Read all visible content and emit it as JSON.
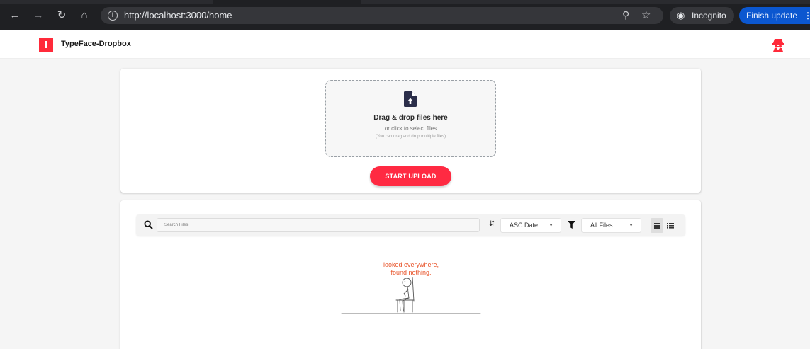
{
  "browser": {
    "url": "http://localhost:3000/home",
    "incognito_label": "Incognito",
    "finish_update_label": "Finish update",
    "icons": [
      "back-icon",
      "forward-icon",
      "reload-icon",
      "home-icon",
      "info-icon",
      "zoom-icon",
      "star-icon",
      "incognito-icon",
      "menu-dots-icon"
    ]
  },
  "header": {
    "brand": "TypeFace-Dropbox",
    "brand_color": "#ff2a3a"
  },
  "upload": {
    "title": "Drag & drop files here",
    "subtitle": "or click to select files",
    "hint": "(You can drag and drop multiple files)",
    "button_label": "START UPLOAD",
    "button_color": "#ff2a42"
  },
  "files": {
    "search_placeholder": "Search Files",
    "sort_value": "ASC Date",
    "filter_value": "All Files",
    "empty_line1": "looked everywhere,",
    "empty_line2": "found nothing.",
    "empty_color": "#e8542a"
  }
}
